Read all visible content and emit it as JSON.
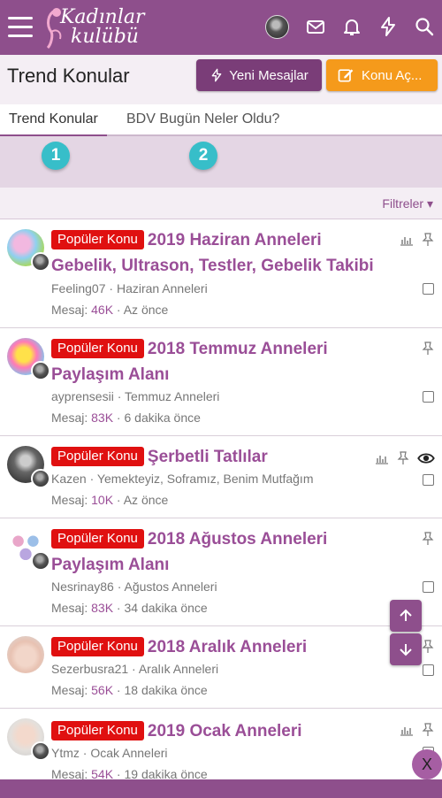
{
  "header": {
    "logo_line1": "Kadınlar",
    "logo_line2": "kulübü",
    "icons": [
      "menu-icon",
      "user-avatar",
      "envelope-icon",
      "bell-icon",
      "bolt-icon",
      "search-icon"
    ]
  },
  "title_bar": {
    "title": "Trend Konular",
    "new_posts_label": "Yeni Mesajlar",
    "open_topic_label": "Konu Aç..."
  },
  "tabs": [
    {
      "label": "Trend Konular",
      "active": true
    },
    {
      "label": "BDV Bugün Neler Oldu?",
      "active": false
    }
  ],
  "steps": [
    "1",
    "2"
  ],
  "filters_label": "Filtreler ▾",
  "badge_label": "Popüler Konu",
  "stats_label": "Mesaj:",
  "threads": [
    {
      "title": "2019 Haziran Anneleri Gebelik, Ultrason, Testler, Gebelik Takibi",
      "author": "Feeling07",
      "forum": "Haziran Anneleri",
      "messages": "46K",
      "time": "Az önce",
      "icons": [
        "chart-icon",
        "pin-icon"
      ]
    },
    {
      "title": "2018 Temmuz Anneleri Paylaşım Alanı",
      "author": "ayprensesii",
      "forum": "Temmuz Anneleri",
      "messages": "83K",
      "time": "6 dakika önce",
      "icons": [
        "pin-icon"
      ]
    },
    {
      "title": "Şerbetli Tatlılar",
      "author": "Kazen",
      "forum": "Yemekteyiz, Soframız, Benim Mutfağım",
      "messages": "10K",
      "time": "Az önce",
      "icons": [
        "chart-icon",
        "pin-icon",
        "eye-icon"
      ]
    },
    {
      "title": "2018 Ağustos Anneleri Paylaşım Alanı",
      "author": "Nesrinay86",
      "forum": "Ağustos Anneleri",
      "messages": "83K",
      "time": "34 dakika önce",
      "icons": [
        "pin-icon"
      ]
    },
    {
      "title": "2018 Aralık Anneleri",
      "author": "Sezerbusra21",
      "forum": "Aralık Anneleri",
      "messages": "56K",
      "time": "18 dakika önce",
      "icons": [
        "pin-icon"
      ]
    },
    {
      "title": "2019 Ocak Anneleri",
      "author": "Ytmz",
      "forum": "Ocak Anneleri",
      "messages": "54K",
      "time": "19 dakika önce",
      "icons": [
        "chart-icon",
        "pin-icon"
      ]
    }
  ],
  "close_label": "X",
  "colors": {
    "primary": "#8e4f8c",
    "accent": "#f59a1b",
    "badge": "#e01010",
    "step": "#37bec9"
  }
}
